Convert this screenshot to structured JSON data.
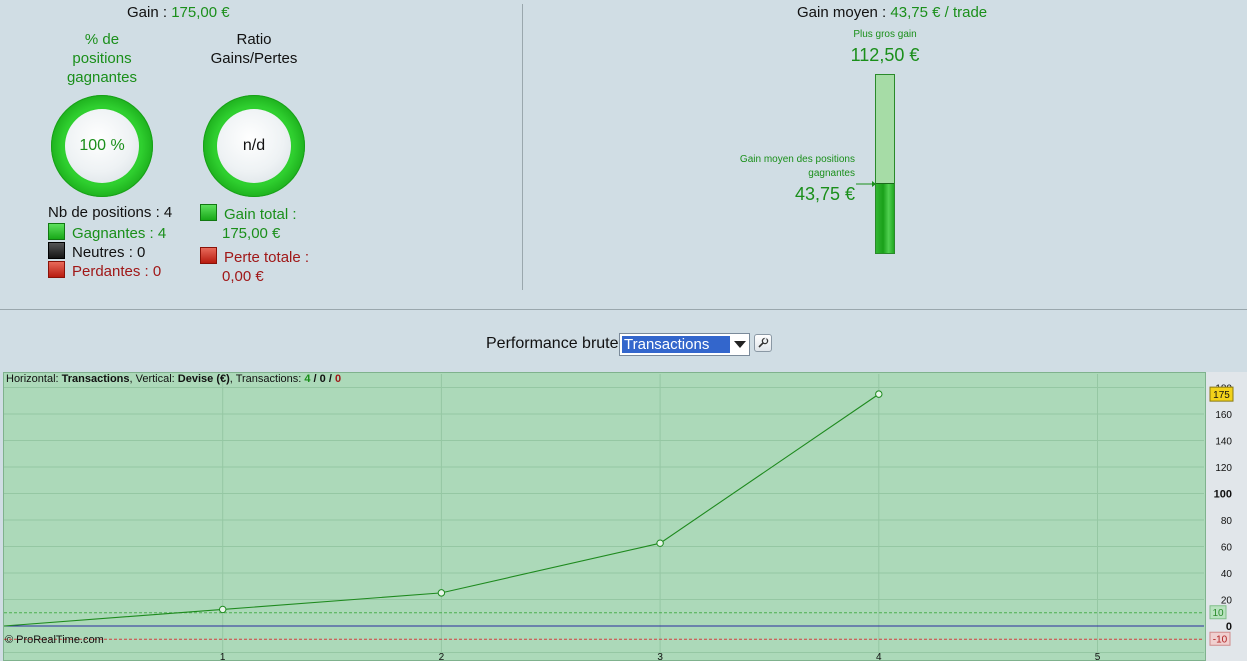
{
  "summary": {
    "gain_label": "Gain : ",
    "gain_value": "175,00 €",
    "pct_winners_title": [
      "% de",
      "positions",
      "gagnantes"
    ],
    "ratio_title": [
      "Ratio",
      "Gains/Pertes"
    ],
    "pct_winners_value": "100 %",
    "ratio_value": "n/d",
    "nb_positions": "Nb de positions : 4",
    "winners": "Gagnantes : 4",
    "neutrals": "Neutres : 0",
    "losers": "Perdantes : 0",
    "total_gain": [
      "Gain total :",
      "175,00 €"
    ],
    "total_loss": [
      "Perte totale :",
      "0,00 €"
    ]
  },
  "avg_gain": {
    "label": "Gain moyen : ",
    "value": "43,75 € / trade",
    "biggest_gain_label": "Plus gros gain",
    "biggest_gain_value": "112,50 €",
    "avg_winner_label": [
      "Gain moyen des positions",
      "gagnantes"
    ],
    "avg_winner_value": "43,75 €",
    "bar_fraction": 0.389
  },
  "perf": {
    "title": "Performance brute",
    "select_value": "Transactions",
    "info": {
      "h_label": "Horizontal: ",
      "h_value": "Transactions",
      "v_label": ", Vertical: ",
      "v_value": "Devise (€)",
      "t_label": ", Transactions: ",
      "t_win": "4",
      "t_sep1": " / ",
      "t_neutral": "0",
      "t_sep2": " / ",
      "t_loss": "0"
    },
    "copyright": "© ProRealTime.com"
  },
  "colors": {
    "green": "#1a8f1a",
    "red": "#a01818",
    "line": "#1e8a1e",
    "zero": "#2a2aa0"
  },
  "chart_data": {
    "type": "line",
    "x": [
      0,
      1,
      2,
      3,
      4
    ],
    "y": [
      0,
      12.5,
      25,
      62.5,
      175
    ],
    "xticks": [
      "1",
      "2",
      "3",
      "4",
      "5"
    ],
    "yticks": [
      -10,
      0,
      10,
      20,
      40,
      60,
      80,
      100,
      120,
      140,
      160,
      180
    ],
    "ylim": [
      -20,
      185
    ],
    "last_value_label": "175",
    "band_labels": [
      "10",
      "-10"
    ],
    "grid": true
  }
}
